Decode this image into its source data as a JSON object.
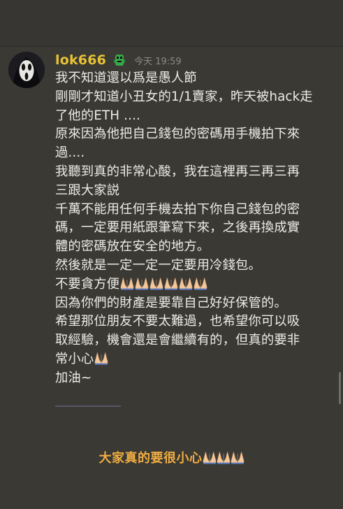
{
  "message": {
    "username": "lok666",
    "user_badge_icon": "green-creature-emoji-icon",
    "timestamp": "今天 19:59",
    "avatar_icon": "ghostface-mask-avatar-icon",
    "lines": [
      "我不知道還以爲是愚人節",
      "剛剛才知道小丑女的1/1賣家，昨天被hack走",
      "了他的ETH ....",
      "原來因為他把自己錢包的密碼用手機拍下來",
      "過....",
      "我聽到真的非常心酸，我在這裡再三再三再",
      "三跟大家説",
      "千萬不能用任何手機去拍下你自己錢包的密",
      "碼，一定要用紙跟筆寫下來，之後再換成實",
      "體的密碼放在安全的地方。",
      "然後就是一定一定一定要用冷錢包。",
      "不要貪方便",
      "因為你們的財產是要靠自己好好保管的。",
      "希望那位朋友不要太難過，也希望你可以吸",
      "取經驗，機會還是會繼續有的，但真的要非",
      "常小心",
      "加油~"
    ],
    "line_12_emoji": "folded-hands-icon",
    "line_12_emoji_count": 6,
    "line_16_emoji": "folded-hands-icon",
    "line_16_emoji_count": 1
  },
  "caption": {
    "text": "大家真的要很小心",
    "emoji": "folded-hands-icon",
    "emoji_count": 3,
    "color": "#f0ad42"
  },
  "colors": {
    "background": "#3a3934",
    "username": "#e8c235",
    "message_text": "#ecebe7",
    "timestamp": "#8d8b84"
  }
}
